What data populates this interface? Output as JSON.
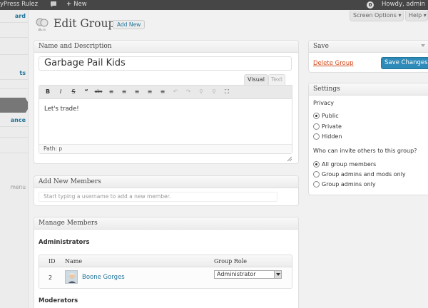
{
  "adminbar": {
    "site_name": "yPress Rulez",
    "new_label": "New",
    "notification_count": "0",
    "howdy": "Howdy, admin"
  },
  "sidebar": {
    "items": [
      {
        "label": "ard"
      },
      {
        "label": "ts"
      },
      {
        "label": "ance"
      },
      {
        "label": "menu"
      }
    ]
  },
  "header": {
    "title": "Edit Group",
    "add_new": "Add New",
    "screen_options": "Screen Options ▾",
    "help": "Help ▾"
  },
  "name_box": {
    "title": "Name and Description",
    "group_name": "Garbage Pail Kids",
    "tab_visual": "Visual",
    "tab_text": "Text",
    "description": "Let's trade!",
    "path": "Path: p",
    "toolbar": [
      "B",
      "I",
      "S",
      "“",
      "abc",
      "≡",
      "≡",
      "≡",
      "≡",
      "≡",
      "↶",
      "↷",
      "⚲",
      "⚲",
      "⛶"
    ]
  },
  "add_members_box": {
    "title": "Add New Members",
    "placeholder": "Start typing a username to add a new member."
  },
  "manage_box": {
    "title": "Manage Members",
    "admins_heading": "Administrators",
    "columns": [
      "ID",
      "Name",
      "Group Role"
    ],
    "rows": [
      {
        "id": "2",
        "name": "Boone Gorges",
        "role": "Administrator"
      }
    ],
    "moderators_heading": "Moderators"
  },
  "save_box": {
    "title": "Save",
    "delete": "Delete Group",
    "save": "Save Changes"
  },
  "settings_box": {
    "title": "Settings",
    "privacy_label": "Privacy",
    "privacy_options": [
      "Public",
      "Private",
      "Hidden"
    ],
    "privacy_selected": "Public",
    "invite_label": "Who can invite others to this group?",
    "invite_options": [
      "All group members",
      "Group admins and mods only",
      "Group admins only"
    ],
    "invite_selected": "All group members"
  },
  "colors": {
    "admin_bar": "#464646",
    "link": "#21759b",
    "primary_button": "#2e8ab8",
    "delete_link": "#d54e21"
  }
}
